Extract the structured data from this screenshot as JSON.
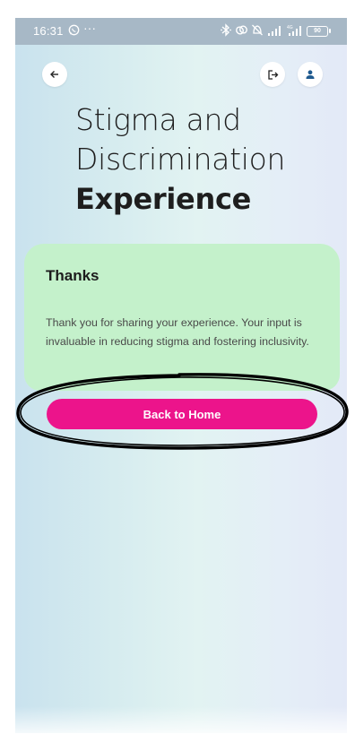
{
  "status_bar": {
    "time": "16:31",
    "more_indicator": "···",
    "battery": "90",
    "icons": [
      "whatsapp-icon",
      "bluetooth-icon",
      "link-icon",
      "alarm-off-icon",
      "signal-icon",
      "signal-4g-icon",
      "battery-icon"
    ]
  },
  "header": {
    "back_icon": "arrow-left-icon",
    "logout_icon": "logout-icon",
    "profile_icon": "person-icon"
  },
  "title": {
    "line1": "Stigma and",
    "line2": "Discrimination",
    "line3": "Experience"
  },
  "card": {
    "heading": "Thanks",
    "body": "Thank you for sharing your experience. Your input is invaluable in reducing stigma and fostering inclusivity."
  },
  "actions": {
    "back_home_label": "Back to Home"
  },
  "colors": {
    "accent_button": "#ec148b",
    "card_background": "#c4f1cb",
    "annotation": "#000000"
  }
}
